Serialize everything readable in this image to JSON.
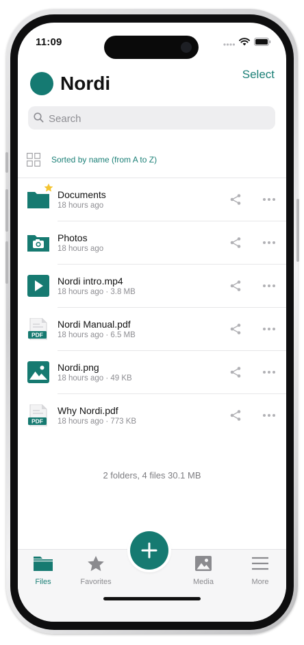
{
  "status_bar": {
    "time": "11:09"
  },
  "header": {
    "title": "Nordi",
    "select_label": "Select"
  },
  "search": {
    "placeholder": "Search"
  },
  "sort": {
    "label": "Sorted by name (from A to Z)"
  },
  "files": [
    {
      "name": "Documents",
      "meta": "18 hours ago",
      "icon": "folder-icon",
      "starred": true
    },
    {
      "name": "Photos",
      "meta": "18 hours ago",
      "icon": "camera-folder-icon"
    },
    {
      "name": "Nordi intro.mp4",
      "meta": "18 hours ago · 3.8 MB",
      "icon": "video-file-icon"
    },
    {
      "name": "Nordi Manual.pdf",
      "meta": "18 hours ago · 6.5 MB",
      "icon": "pdf-file-icon",
      "badge": "PDF"
    },
    {
      "name": "Nordi.png",
      "meta": "18 hours ago · 49 KB",
      "icon": "image-file-icon"
    },
    {
      "name": "Why Nordi.pdf",
      "meta": "18 hours ago · 773 KB",
      "icon": "pdf-file-icon",
      "badge": "PDF"
    }
  ],
  "summary": "2 folders, 4 files 30.1 MB",
  "tabbar": {
    "items": [
      {
        "label": "Files",
        "icon": "folder-icon",
        "active": true
      },
      {
        "label": "Favorites",
        "icon": "star-icon"
      },
      {
        "label": "Media",
        "icon": "image-icon"
      },
      {
        "label": "More",
        "icon": "menu-icon"
      }
    ],
    "add_button_icon": "plus-icon"
  },
  "colors": {
    "accent": "#1a7f76",
    "icon_teal": "#167a71",
    "star": "#f4c430"
  }
}
